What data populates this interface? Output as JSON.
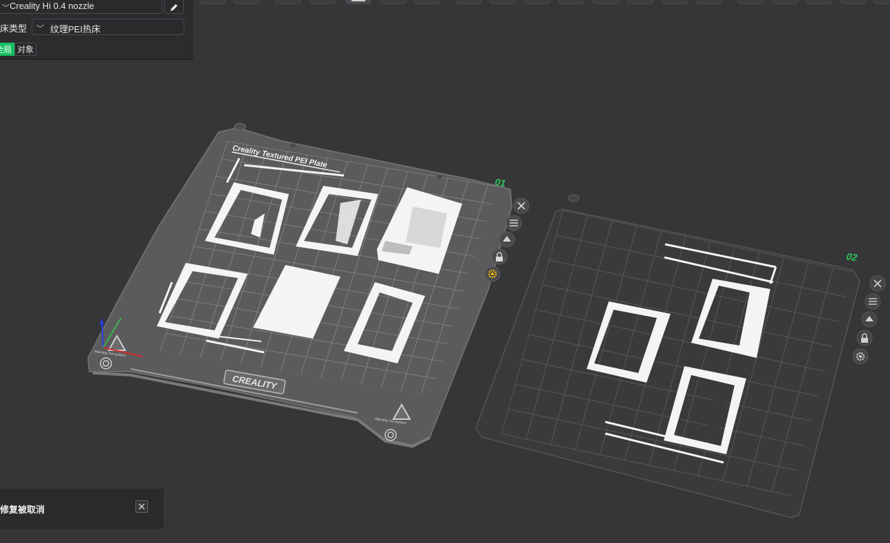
{
  "settings": {
    "printer_name": "Creality Hi 0.4 nozzle",
    "bed_label": "床类型",
    "bed_value": "纹理PEI热床",
    "scope_global": "全局",
    "scope_object": "对象"
  },
  "plates": {
    "plate1_number": "01",
    "plate1_title": "Creality Textured PEI Plate",
    "plate1_brand": "CREALITY",
    "plate1_warning": "Warning: hot surface",
    "plate2_number": "02"
  },
  "notification": {
    "text": "修复被取消"
  },
  "colors": {
    "background": "#363638",
    "panel": "#2c2c2f",
    "accent_green": "#17c162",
    "plate_number": "#2fc75c",
    "active_plate_gear": "#f2b705"
  },
  "icons": [
    "chevron-down-icon",
    "edit-pencil-icon",
    "close-icon",
    "arrange-icon",
    "orient-icon",
    "lock-icon",
    "gear-icon"
  ]
}
